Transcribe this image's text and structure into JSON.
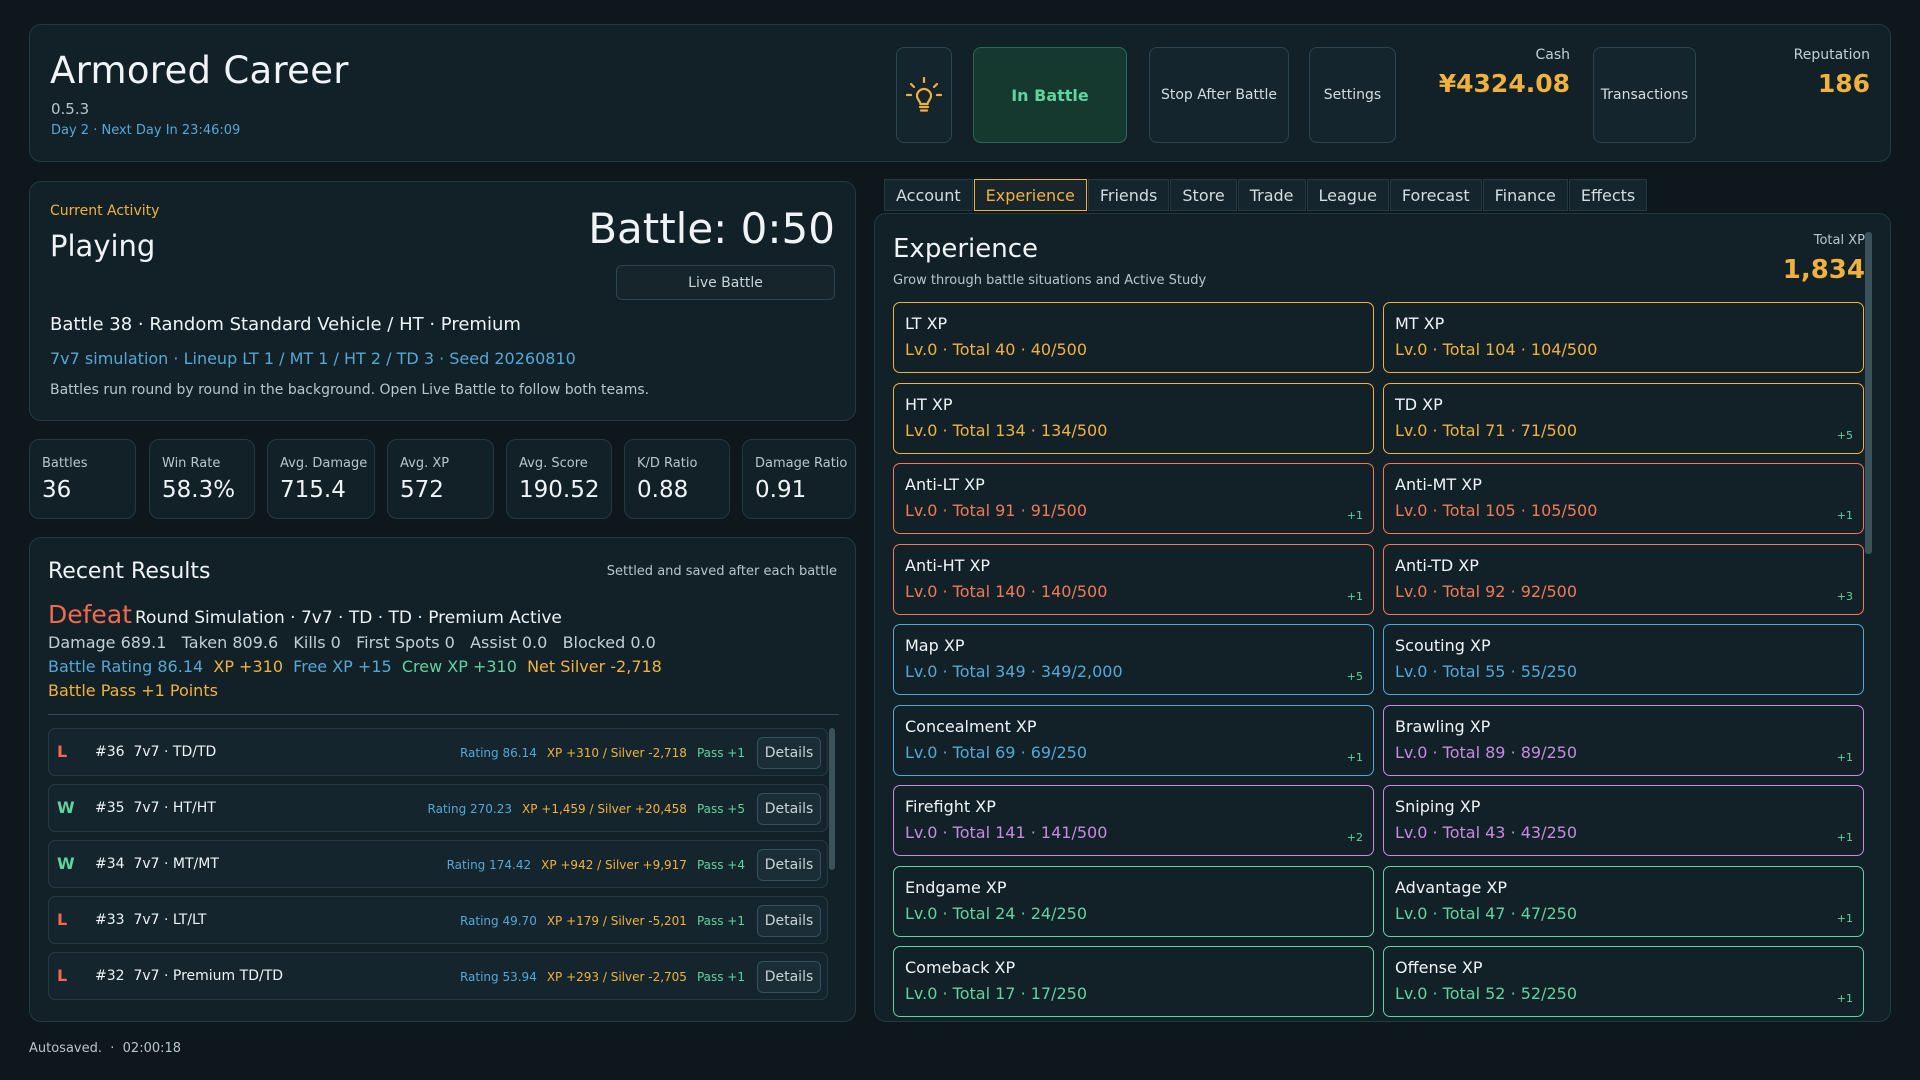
{
  "header": {
    "title": "Armored Career",
    "version": "0.5.3",
    "day_info": "Day 2 · Next Day In 23:46:09",
    "in_battle_label": "In Battle",
    "stop_label": "Stop After Battle",
    "settings_label": "Settings",
    "transactions_label": "Transactions",
    "cash_label": "Cash",
    "cash_value": "¥4324.08",
    "reputation_label": "Reputation",
    "reputation_value": "186",
    "tip_icon": "lightbulb-icon"
  },
  "activity": {
    "label": "Current Activity",
    "state": "Playing",
    "timer": "Battle: 0:50",
    "live_label": "Live Battle",
    "line1": "Battle 38 · Random Standard Vehicle / HT · Premium",
    "line2": "7v7 simulation · Lineup LT 1 / MT 1 / HT 2 / TD 3 · Seed 20260810",
    "line3": "Battles run round by round in the background. Open Live Battle to follow both teams."
  },
  "stats": [
    {
      "label": "Battles",
      "value": "36"
    },
    {
      "label": "Win Rate",
      "value": "58.3%"
    },
    {
      "label": "Avg. Damage",
      "value": "715.4"
    },
    {
      "label": "Avg. XP",
      "value": "572"
    },
    {
      "label": "Avg. Score",
      "value": "190.52"
    },
    {
      "label": "K/D Ratio",
      "value": "0.88"
    },
    {
      "label": "Damage Ratio",
      "value": "0.91"
    }
  ],
  "recent": {
    "title": "Recent Results",
    "note": "Settled and saved after each battle",
    "outcome": "Defeat",
    "outcome_desc": "Round Simulation · 7v7 · TD · TD · Premium Active",
    "stats_line": "Damage 689.1   Taken 809.6   Kills 0   First Spots 0   Assist 0.0   Blocked 0.0",
    "rating": "Battle Rating 86.14",
    "xp": "XP +310",
    "free_xp": "Free XP +15",
    "crew_xp": "Crew XP +310",
    "net_silver": "Net Silver -2,718",
    "pass": "Battle Pass +1 Points",
    "details_label": "Details",
    "rows": [
      {
        "res": "L",
        "title": "#36  7v7 · TD/TD",
        "rating": "Rating 86.14",
        "xp": "XP +310 / Silver -2,718",
        "pass": "Pass +1"
      },
      {
        "res": "W",
        "title": "#35  7v7 · HT/HT",
        "rating": "Rating 270.23",
        "xp": "XP +1,459 / Silver +20,458",
        "pass": "Pass +5"
      },
      {
        "res": "W",
        "title": "#34  7v7 · MT/MT",
        "rating": "Rating 174.42",
        "xp": "XP +942 / Silver +9,917",
        "pass": "Pass +4"
      },
      {
        "res": "L",
        "title": "#33  7v7 · LT/LT",
        "rating": "Rating 49.70",
        "xp": "XP +179 / Silver -5,201",
        "pass": "Pass +1"
      },
      {
        "res": "L",
        "title": "#32  7v7 · Premium TD/TD",
        "rating": "Rating 53.94",
        "xp": "XP +293 / Silver -2,705",
        "pass": "Pass +1"
      }
    ]
  },
  "tabs": [
    "Account",
    "Experience",
    "Friends",
    "Store",
    "Trade",
    "League",
    "Forecast",
    "Finance",
    "Effects"
  ],
  "active_tab": "Experience",
  "experience": {
    "title": "Experience",
    "subtitle": "Grow through battle situations and Active Study",
    "total_label": "Total XP",
    "total_value": "1,834",
    "items": [
      {
        "name": "LT XP",
        "stat": "Lv.0 · Total 40 · 40/500",
        "delta": "",
        "color": "#f0b23f"
      },
      {
        "name": "MT XP",
        "stat": "Lv.0 · Total 104 · 104/500",
        "delta": "",
        "color": "#f0b23f"
      },
      {
        "name": "HT XP",
        "stat": "Lv.0 · Total 134 · 134/500",
        "delta": "",
        "color": "#f0b23f"
      },
      {
        "name": "TD XP",
        "stat": "Lv.0 · Total 71 · 71/500",
        "delta": "+5",
        "color": "#f0b23f"
      },
      {
        "name": "Anti-LT XP",
        "stat": "Lv.0 · Total 91 · 91/500",
        "delta": "+1",
        "color": "#ef7a55"
      },
      {
        "name": "Anti-MT XP",
        "stat": "Lv.0 · Total 105 · 105/500",
        "delta": "+1",
        "color": "#ef7a55"
      },
      {
        "name": "Anti-HT XP",
        "stat": "Lv.0 · Total 140 · 140/500",
        "delta": "+1",
        "color": "#ef7a55"
      },
      {
        "name": "Anti-TD XP",
        "stat": "Lv.0 · Total 92 · 92/500",
        "delta": "+3",
        "color": "#ef7a55"
      },
      {
        "name": "Map XP",
        "stat": "Lv.0 · Total 349 · 349/2,000",
        "delta": "+5",
        "color": "#54a8d6"
      },
      {
        "name": "Scouting XP",
        "stat": "Lv.0 · Total 55 · 55/250",
        "delta": "",
        "color": "#54a8d6"
      },
      {
        "name": "Concealment XP",
        "stat": "Lv.0 · Total 69 · 69/250",
        "delta": "+1",
        "color": "#54a8d6"
      },
      {
        "name": "Brawling XP",
        "stat": "Lv.0 · Total 89 · 89/250",
        "delta": "+1",
        "color": "#c78be0"
      },
      {
        "name": "Firefight XP",
        "stat": "Lv.0 · Total 141 · 141/500",
        "delta": "+2",
        "color": "#c78be0"
      },
      {
        "name": "Sniping XP",
        "stat": "Lv.0 · Total 43 · 43/250",
        "delta": "+1",
        "color": "#c78be0"
      },
      {
        "name": "Endgame XP",
        "stat": "Lv.0 · Total 24 · 24/250",
        "delta": "",
        "color": "#5fd49d"
      },
      {
        "name": "Advantage XP",
        "stat": "Lv.0 · Total 47 · 47/250",
        "delta": "+1",
        "color": "#5fd49d"
      },
      {
        "name": "Comeback XP",
        "stat": "Lv.0 · Total 17 · 17/250",
        "delta": "",
        "color": "#5fd49d"
      },
      {
        "name": "Offense XP",
        "stat": "Lv.0 · Total 52 · 52/250",
        "delta": "+1",
        "color": "#5fd49d"
      }
    ]
  },
  "footer": "Autosaved.  ·  02:00:18",
  "colors": {
    "win": "#5fd49d",
    "loss": "#ef6a4f",
    "accent": "#f0b23f",
    "blue": "#54a8d6"
  }
}
